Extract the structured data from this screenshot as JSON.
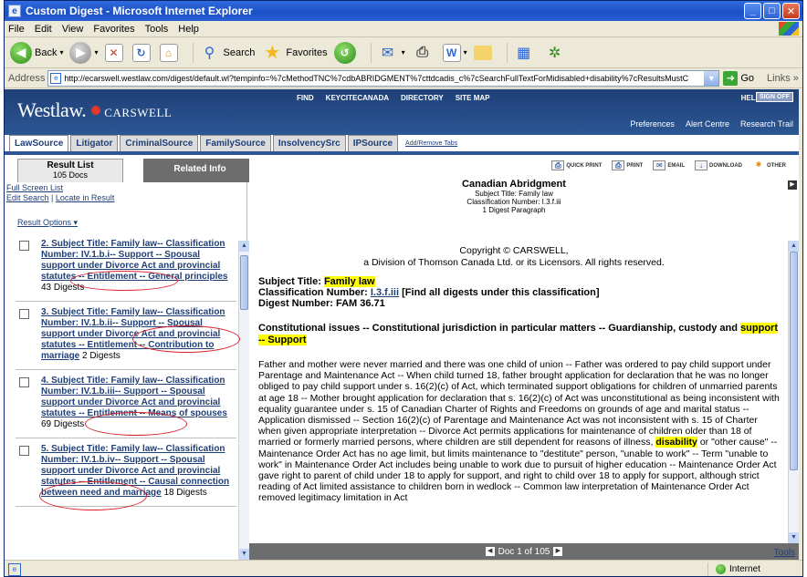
{
  "window": {
    "title": "Custom Digest - Microsoft Internet Explorer",
    "controls": {
      "minimize": "_",
      "maximize": "□",
      "close": "✕"
    }
  },
  "menu": [
    "File",
    "Edit",
    "View",
    "Favorites",
    "Tools",
    "Help"
  ],
  "toolbar": {
    "back": "Back",
    "search": "Search",
    "favorites": "Favorites"
  },
  "address": {
    "label": "Address",
    "url": "http://ecarswell.westlaw.com/digest/default.wl?tempinfo=%7cMethodTNC%7cdbABRIDGMENT%7cttdcadis_c%7cSearchFullTextForMidisabled+disability%7cResultsMustC",
    "go": "Go",
    "links": "Links"
  },
  "westlaw": {
    "logo": "Westlaw.",
    "brand": "CARSWELL",
    "nav": [
      "FIND",
      "KEYCITECANADA",
      "DIRECTORY",
      "SITE MAP"
    ],
    "help": "HELP",
    "signoff": "SIGN OFF",
    "util": [
      "Preferences",
      "Alert Centre",
      "Research Trail"
    ]
  },
  "tabs": [
    "LawSource",
    "Litigator",
    "CriminalSource",
    "FamilySource",
    "InsolvencySrc",
    "IPSource"
  ],
  "add_tabs": "Add/Remove Tabs",
  "left": {
    "result_list": "Result List",
    "doc_count": "105 Docs",
    "related_info": "Related Info",
    "full_screen": "Full Screen List",
    "edit_search": "Edit Search",
    "locate": "Locate in Result",
    "link_sep": " | ",
    "result_options": "Result Options ▾",
    "results": [
      {
        "text": "2. Subject Title: Family law-- Classification Number: IV.1.b.i-- Support -- Spousal support under Divorce Act and provincial statutes -- Entitlement -- General principles",
        "count": "43 Digests"
      },
      {
        "text": "3. Subject Title: Family law-- Classification Number: IV.1.b.ii-- Support -- Spousal support under Divorce Act and provincial statutes -- Entitlement -- Contribution to marriage",
        "count": "2 Digests"
      },
      {
        "text": "4. Subject Title: Family law-- Classification Number: IV.1.b.iii-- Support -- Spousal support under Divorce Act and provincial statutes -- Entitlement -- Means of spouses",
        "count": "69 Digests"
      },
      {
        "text": "5. Subject Title: Family law-- Classification Number: IV.1.b.iv-- Support -- Spousal support under Divorce Act and provincial statutes -- Entitlement -- Causal connection between need and marriage",
        "count": "18 Digests"
      }
    ]
  },
  "right": {
    "tools": [
      "QUICK PRINT",
      "PRINT",
      "EMAIL",
      "DOWNLOAD",
      "OTHER"
    ],
    "doc_title": "Canadian Abridgment",
    "doc_subject": "Subject Title: Family law",
    "doc_class": "Classification Number: I.3.f.iii",
    "doc_paragraph": "1 Digest Paragraph",
    "copyright_1": "Copyright © CARSWELL,",
    "copyright_2": "a Division of Thomson Canada Ltd. or its Licensors. All rights reserved.",
    "subject_label": "Subject Title:",
    "subject_value": "Family law",
    "class_label": "Classification Number:",
    "class_value": "I.3.f.iii",
    "class_extra": "[Find all digests under this classification]",
    "digest_label": "Digest Number:",
    "digest_value": "FAM 36.71",
    "headnote_a": "Constitutional issues -- Constitutional jurisdiction in particular matters -- Guardianship, custody and",
    "headnote_hl": "support -- Support",
    "body_a": "Father and mother were never married and there was one child of union -- Father was ordered to pay child support under Parentage and Maintenance Act -- When child turned 18, father brought application for declaration that he was no longer obliged to pay child support under s. 16(2)(c) of Act, which terminated support obligations for children of unmarried parents at age 18 -- Mother brought application for declaration that s. 16(2)(c) of Act was unconstitutional as being inconsistent with equality guarantee under s. 15 of Canadian Charter of Rights and Freedoms on grounds of age and marital status -- Application dismissed -- Section 16(2)(c) of Parentage and Maintenance Act was not inconsistent with s. 15 of Charter when given appropriate interpretation -- Divorce Act permits applications for maintenance of children older than 18 of married or formerly married persons, where children are still dependent for reasons of illness,",
    "body_hl": "disability",
    "body_b": "or \"other cause\" -- Maintenance Order Act has no age limit, but limits maintenance to \"destitute\" person, \"unable to work\" -- Term \"unable to work\" in Maintenance Order Act includes being unable to work due to pursuit of higher education -- Maintenance Order Act gave right to parent of child under 18 to apply for support, and right to child over 18 to apply for support, although strict reading of Act limited assistance to children born in wedlock -- Common law interpretation of Maintenance Order Act removed legitimacy limitation in Act",
    "doc_nav": "Doc 1 of 105",
    "tools_link": "Tools"
  },
  "status": {
    "zone": "Internet"
  },
  "colors": {
    "westlaw_blue": "#2c5794",
    "highlight": "#ffff00",
    "annotation_red": "#d8202a"
  }
}
